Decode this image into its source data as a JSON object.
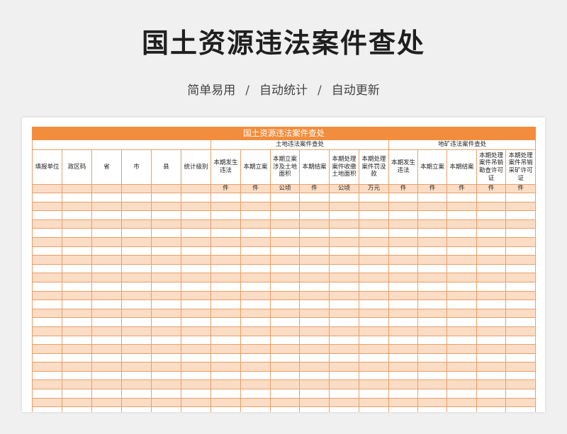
{
  "title": "国土资源违法案件查处",
  "subtitle": {
    "item1": "简单易用",
    "sep": "/",
    "item2": "自动统计",
    "item3": "自动更新"
  },
  "table": {
    "banner": "国土资源违法案件查处",
    "group_land": "土地违法案件查处",
    "group_mine": "地矿违法案件查处",
    "base_headers": [
      "填报单位",
      "政区码",
      "省",
      "市",
      "县",
      "统计级别"
    ],
    "land_headers": [
      "本期发生违法",
      "本期立案",
      "本期立案涉及土地面积",
      "本期结案",
      "本期处理案件收缴土地面积",
      "本期处理案件罚没款"
    ],
    "mine_headers": [
      "本期发生违法",
      "本期立案",
      "本期结案",
      "本期处理案件吊销勘查许可证",
      "本期处理案件吊销采矿许可证"
    ],
    "land_units": [
      "件",
      "件",
      "公顷",
      "件",
      "公顷",
      "万元"
    ],
    "mine_units": [
      "件",
      "件",
      "件",
      "件",
      "件"
    ],
    "empty_rows": 25
  },
  "colors": {
    "accent": "#f28d3d",
    "band": "#fbdcc4",
    "border": "#e9a06a"
  }
}
